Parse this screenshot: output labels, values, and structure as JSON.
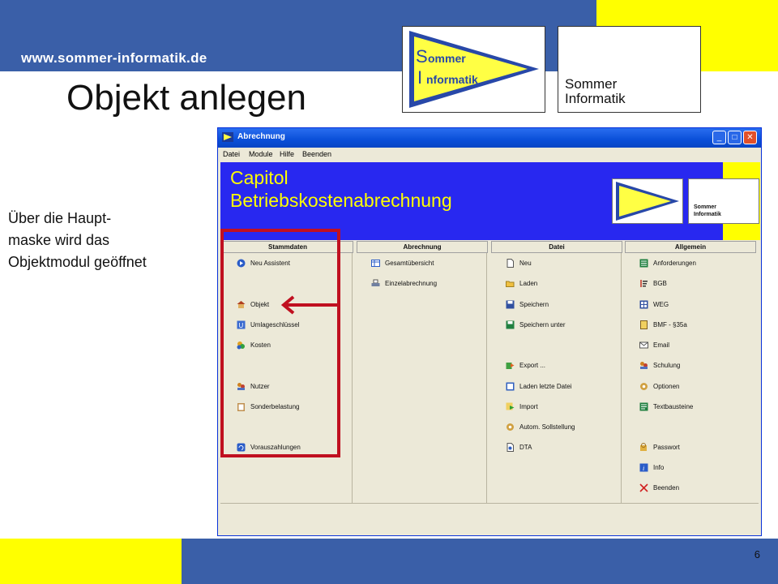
{
  "slide": {
    "url": "www.sommer-informatik.de",
    "title": "Objekt anlegen",
    "caption_lines": [
      "Über die Haupt-",
      "maske wird das",
      "Objektmodul geöffnet"
    ],
    "page_number": "6",
    "logo_pennant_top": "ommer",
    "logo_pennant_bottom": "nformatik",
    "logo_pennant_letter_s": "S",
    "logo_pennant_letter_i": "I",
    "logo_text_line1": "Sommer",
    "logo_text_line2": "Informatik"
  },
  "window": {
    "title": "Abrechnung",
    "menu": [
      "Datei",
      "Module",
      "Hilfe",
      "Beenden"
    ],
    "banner_line1": "Capitol",
    "banner_line2": "Betriebskostenabrechnung",
    "mini_logo_text_line1": "Sommer",
    "mini_logo_text_line2": "Informatik",
    "columns": [
      {
        "header": "Stammdaten",
        "items": [
          "Neu Assistent",
          "Objekt",
          "Umlageschlüssel",
          "Kosten",
          "Nutzer",
          "Sonderbelastung",
          "Vorauszahlungen"
        ]
      },
      {
        "header": "Abrechnung",
        "items": [
          "Gesamtübersicht",
          "Einzelabrechnung"
        ]
      },
      {
        "header": "Datei",
        "items": [
          "Neu",
          "Laden",
          "Speichern",
          "Speichern unter",
          "Export ...",
          "Laden letzte Datei",
          "Import",
          "Autom. Sollstellung",
          "DTA"
        ]
      },
      {
        "header": "Allgemein",
        "items": [
          "Anforderungen",
          "BGB",
          "WEG",
          "BMF - §35a",
          "Email",
          "Schulung",
          "Optionen",
          "Textbausteine",
          "Passwort",
          "Info",
          "Beenden"
        ]
      }
    ]
  },
  "colors": {
    "slide_blue": "#3a5fa8",
    "slide_yellow": "#ffff00",
    "banner_blue": "#2828f0",
    "highlight_red": "#c01020"
  },
  "icons": {
    "neu_assistent": "arrow-circle-icon",
    "objekt": "house-icon",
    "umlage": "u-box-icon",
    "kosten": "coins-icon",
    "nutzer": "people-icon",
    "sonder": "clipboard-icon",
    "voraus": "refresh-icon"
  }
}
